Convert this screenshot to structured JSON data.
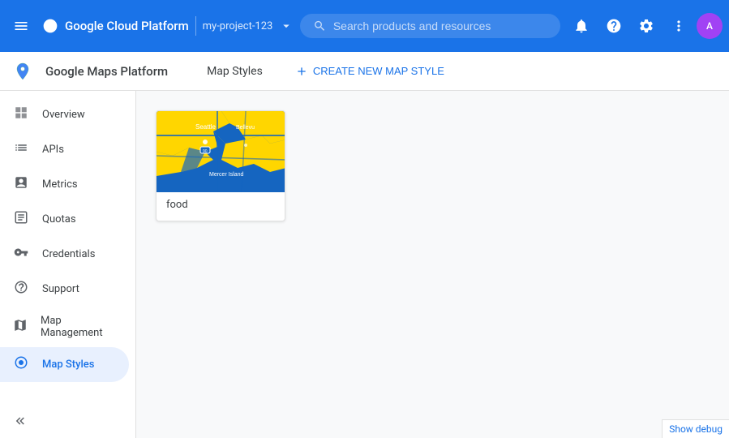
{
  "topbar": {
    "title": "Google Cloud Platform",
    "project": "my-project-123",
    "search_placeholder": "Search products and resources",
    "dropdown_icon": "▾"
  },
  "subheader": {
    "title": "Google Maps Platform",
    "nav_item": "Map Styles",
    "create_btn": "CREATE NEW MAP STYLE"
  },
  "sidebar": {
    "items": [
      {
        "id": "overview",
        "label": "Overview",
        "icon": "⊞"
      },
      {
        "id": "apis",
        "label": "APIs",
        "icon": "≡"
      },
      {
        "id": "metrics",
        "label": "Metrics",
        "icon": "⬛"
      },
      {
        "id": "quotas",
        "label": "Quotas",
        "icon": "☐"
      },
      {
        "id": "credentials",
        "label": "Credentials",
        "icon": "🔑"
      },
      {
        "id": "support",
        "label": "Support",
        "icon": "👤"
      },
      {
        "id": "map-management",
        "label": "Map Management",
        "icon": "⬛"
      },
      {
        "id": "map-styles",
        "label": "Map Styles",
        "icon": "◎"
      }
    ]
  },
  "content": {
    "map_card": {
      "label": "food"
    }
  },
  "debug": {
    "label": "Show debug"
  }
}
